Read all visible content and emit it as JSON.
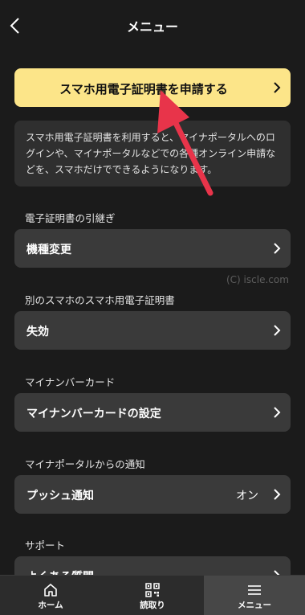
{
  "header": {
    "title": "メニュー",
    "back_icon": "chevron-left-icon"
  },
  "cta": {
    "label": "スマホ用電子証明書を申請する",
    "color": "#fce589"
  },
  "description": "スマホ用電子証明書を利用すると、マイナポータルへのログインや、マイナポータルなどでの各種オンライン申請などを、スマホだけでできるようになります。",
  "sections": [
    {
      "title": "電子証明書の引継ぎ",
      "rows": [
        {
          "label": "機種変更"
        }
      ]
    },
    {
      "title": "別のスマホのスマホ用電子証明書",
      "rows": [
        {
          "label": "失効"
        }
      ]
    },
    {
      "title": "マイナンバーカード",
      "rows": [
        {
          "label": "マイナンバーカードの設定"
        }
      ]
    },
    {
      "title": "マイナポータルからの通知",
      "rows": [
        {
          "label": "プッシュ通知",
          "value": "オン"
        }
      ]
    },
    {
      "title": "サポート",
      "rows": [
        {
          "label": "よくある質問"
        }
      ]
    }
  ],
  "watermark": "(C) iscle.com",
  "annotation_arrow_color": "#e8344a",
  "tabbar": {
    "tabs": [
      {
        "label": "ホーム",
        "icon": "home-icon"
      },
      {
        "label": "読取り",
        "icon": "qr-code-icon"
      },
      {
        "label": "メニュー",
        "icon": "menu-icon",
        "active": true
      }
    ]
  }
}
